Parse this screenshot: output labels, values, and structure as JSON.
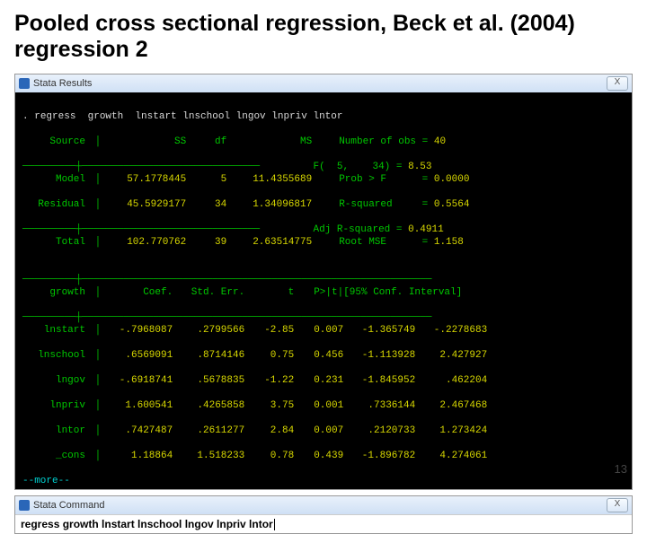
{
  "title": "Pooled cross sectional regression, Beck et al. (2004) regression 2",
  "resultsWin": {
    "title": "Stata Results",
    "close": "X"
  },
  "cmdWin": {
    "title": "Stata Command",
    "close": "X"
  },
  "prompt": ".",
  "cmdEcho": "regress  growth  lnstart lnschool lngov lnpriv lntor",
  "anova": {
    "h": {
      "source": "Source",
      "ss": "SS",
      "df": "df",
      "ms": "MS"
    },
    "rows": [
      {
        "source": "Model",
        "ss": "57.1778445",
        "df": "5",
        "ms": "11.4355689"
      },
      {
        "source": "Residual",
        "ss": "45.5929177",
        "df": "34",
        "ms": "1.34096817"
      }
    ],
    "total": {
      "source": "Total",
      "ss": "102.770762",
      "df": "39",
      "ms": "2.63514775"
    }
  },
  "stats": [
    {
      "l": "Number of obs =",
      "v": "40"
    },
    {
      "l": "F(  5,    34) =",
      "v": "8.53"
    },
    {
      "l": "Prob > F      =",
      "v": "0.0000"
    },
    {
      "l": "R-squared     =",
      "v": "0.5564"
    },
    {
      "l": "Adj R-squared =",
      "v": "0.4911"
    },
    {
      "l": "Root MSE      =",
      "v": "1.158"
    }
  ],
  "coefH": {
    "dep": "growth",
    "coef": "Coef.",
    "se": "Std. Err.",
    "t": "t",
    "p": "P>|t|",
    "ci": "[95% Conf. Interval]"
  },
  "coef": [
    {
      "n": "lnstart",
      "c": "-.7968087",
      "s": ".2799566",
      "t": "-2.85",
      "p": "0.007",
      "lo": "-1.365749",
      "hi": "-.2278683"
    },
    {
      "n": "lnschool",
      "c": ".6569091",
      "s": ".8714146",
      "t": "0.75",
      "p": "0.456",
      "lo": "-1.113928",
      "hi": "2.427927"
    },
    {
      "n": "lngov",
      "c": "-.6918741",
      "s": ".5678835",
      "t": "-1.22",
      "p": "0.231",
      "lo": "-1.845952",
      "hi": ".462204"
    },
    {
      "n": "lnpriv",
      "c": "1.600541",
      "s": ".4265858",
      "t": "3.75",
      "p": "0.001",
      "lo": ".7336144",
      "hi": "2.467468"
    },
    {
      "n": "lntor",
      "c": ".7427487",
      "s": ".2611277",
      "t": "2.84",
      "p": "0.007",
      "lo": ".2120733",
      "hi": "1.273424"
    },
    {
      "n": "_cons",
      "c": "1.18864",
      "s": "1.518233",
      "t": "0.78",
      "p": "0.439",
      "lo": "-1.896782",
      "hi": "4.274061"
    }
  ],
  "more": "--more--",
  "cmdInput": "regress  growth  lnstart lnschool lngov lnpriv lntor",
  "hline1": "─────────┼──────────────────────────────",
  "hline2": "─────────┼───────────────────────────────────────────────────────────",
  "pagenum": "13"
}
